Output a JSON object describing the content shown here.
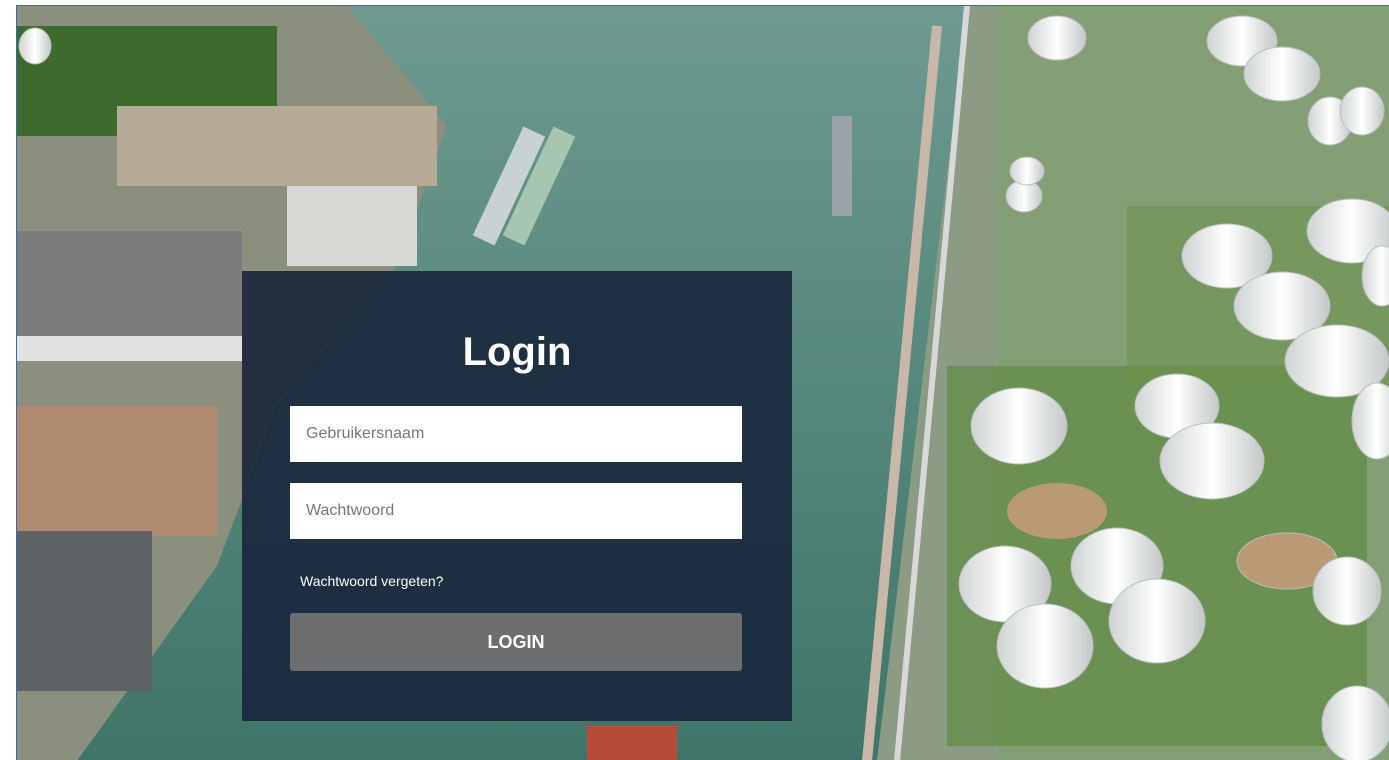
{
  "login": {
    "title": "Login",
    "username_placeholder": "Gebruikersnaam",
    "password_placeholder": "Wachtwoord",
    "forgot_password_label": "Wachtwoord vergeten?",
    "submit_label": "LOGIN"
  },
  "colors": {
    "panel": "#18263c",
    "button": "#6c6e70",
    "water": "#5f8f86",
    "frame_border": "#2e6fb0"
  }
}
